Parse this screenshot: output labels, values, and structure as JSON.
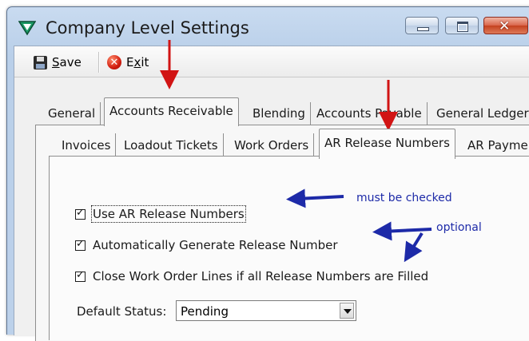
{
  "window": {
    "title": "Company Level Settings",
    "icon": "app-triangle-icon",
    "controls": {
      "minimize": "minimize-icon",
      "maximize": "maximize-icon",
      "close": "✕"
    }
  },
  "toolbar": {
    "save_prefix": "",
    "save_underline": "S",
    "save_rest": "ave",
    "exit_prefix": "E",
    "exit_underline": "x",
    "exit_rest": "it"
  },
  "outer_tabs": [
    {
      "label": "General"
    },
    {
      "label": "Accounts Receivable"
    },
    {
      "label": "Blending"
    },
    {
      "label": "Accounts Payable"
    },
    {
      "label": "General Ledger"
    }
  ],
  "inner_tabs": [
    {
      "label": "Invoices"
    },
    {
      "label": "Loadout Tickets"
    },
    {
      "label": "Work Orders"
    },
    {
      "label": "AR Release Numbers"
    },
    {
      "label": "AR Payme"
    }
  ],
  "settings": {
    "use_ar_release": {
      "label": "Use AR Release Numbers",
      "checked": true
    },
    "auto_generate": {
      "label": "Automatically Generate Release Number",
      "checked": true
    },
    "close_lines": {
      "label": "Close Work Order Lines if all Release Numbers are Filled",
      "checked": true
    },
    "default_status_label": "Default Status:",
    "default_status_value": "Pending"
  },
  "annotations": {
    "must_be_checked": "must be checked",
    "optional": "optional"
  },
  "colors": {
    "annotation_blue": "#1d2aa8",
    "annotation_red": "#d11414",
    "titlebar": "#c9dbf0"
  }
}
